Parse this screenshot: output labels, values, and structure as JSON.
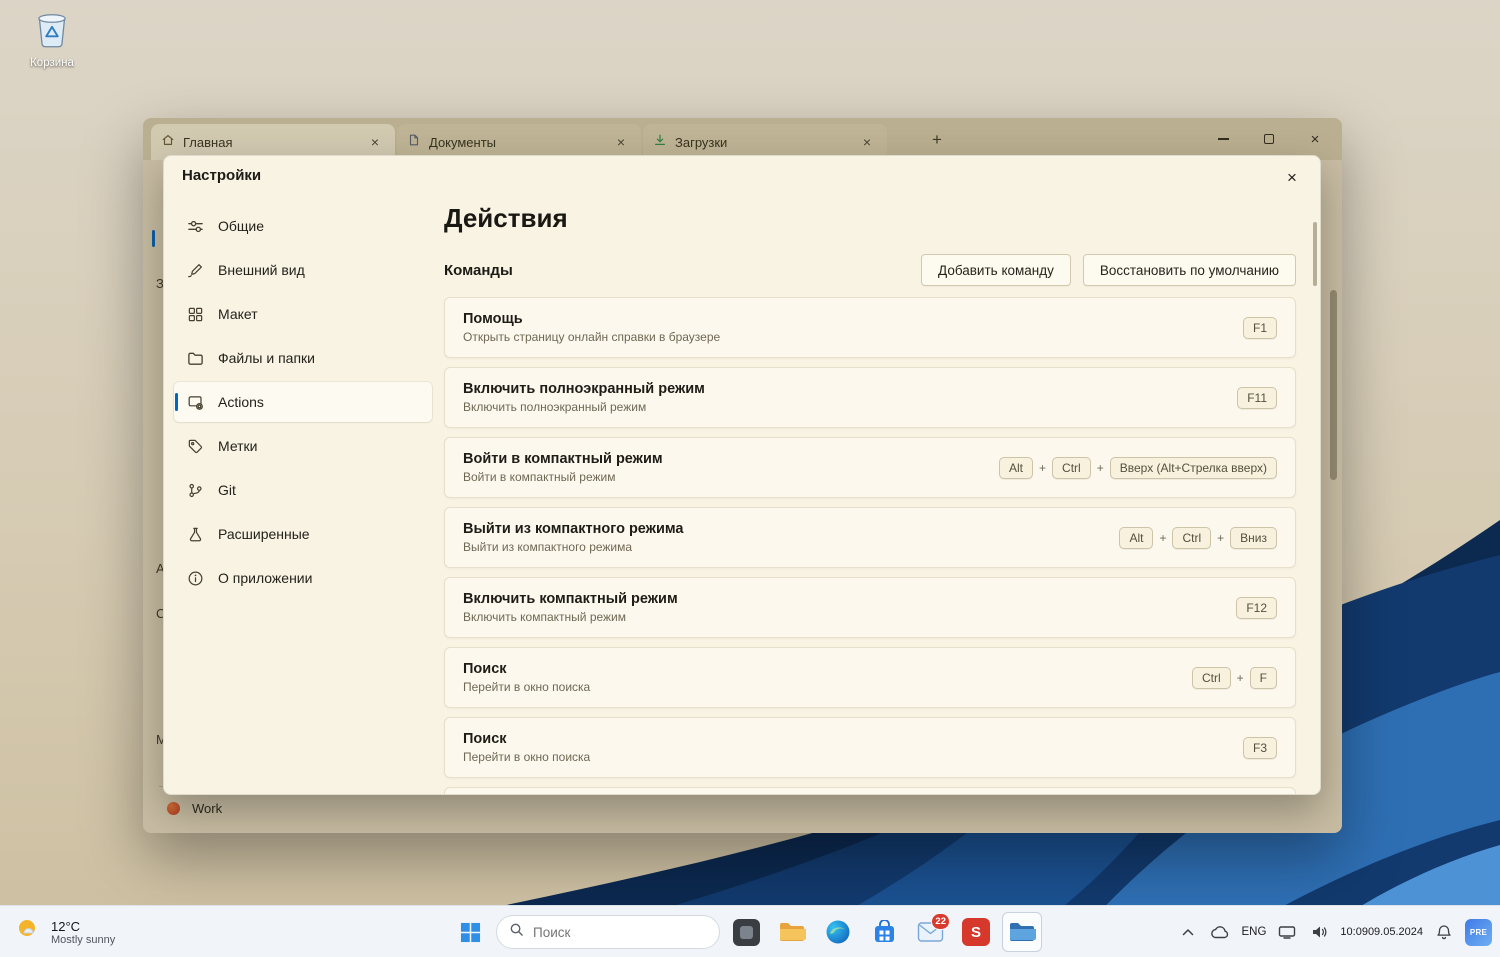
{
  "desktop": {
    "recycle_bin": {
      "label": "Корзина"
    }
  },
  "window": {
    "tabs": [
      {
        "label": "Главная",
        "icon": "home-icon",
        "active": true
      },
      {
        "label": "Документы",
        "icon": "document-icon",
        "active": false
      },
      {
        "label": "Загрузки",
        "icon": "download-icon",
        "active": false
      }
    ],
    "partial_sidebar": [
      "З",
      "А",
      "С",
      "М"
    ],
    "footer": {
      "work_label": "Work"
    }
  },
  "dialog": {
    "title": "Настройки",
    "page_title": "Действия",
    "section_title": "Команды",
    "add_command_label": "Добавить команду",
    "restore_defaults_label": "Восстановить по умолчанию",
    "accent_color": "#0067c0",
    "sidebar": [
      {
        "label": "Общие",
        "icon": "general-icon"
      },
      {
        "label": "Внешний вид",
        "icon": "appearance-icon"
      },
      {
        "label": "Макет",
        "icon": "layout-icon"
      },
      {
        "label": "Файлы и папки",
        "icon": "folders-icon"
      },
      {
        "label": "Actions",
        "icon": "actions-icon",
        "selected": true
      },
      {
        "label": "Метки",
        "icon": "tags-icon"
      },
      {
        "label": "Git",
        "icon": "git-icon"
      },
      {
        "label": "Расширенные",
        "icon": "advanced-icon"
      },
      {
        "label": "О приложении",
        "icon": "about-icon"
      }
    ],
    "commands": [
      {
        "title": "Помощь",
        "subtitle": "Открыть страницу онлайн справки в браузере",
        "keys": [
          "F1"
        ]
      },
      {
        "title": "Включить полноэкранный режим",
        "subtitle": "Включить полноэкранный режим",
        "keys": [
          "F11"
        ]
      },
      {
        "title": "Войти в компактный режим",
        "subtitle": "Войти в компактный режим",
        "keys": [
          "Alt",
          "Ctrl",
          "Вверх (Alt+Стрелка вверх)"
        ]
      },
      {
        "title": "Выйти из компактного режима",
        "subtitle": "Выйти из компактного режима",
        "keys": [
          "Alt",
          "Ctrl",
          "Вниз"
        ]
      },
      {
        "title": "Включить компактный режим",
        "subtitle": "Включить компактный режим",
        "keys": [
          "F12"
        ]
      },
      {
        "title": "Поиск",
        "subtitle": "Перейти в окно поиска",
        "keys": [
          "Ctrl",
          "F"
        ]
      },
      {
        "title": "Поиск",
        "subtitle": "Перейти в окно поиска",
        "keys": [
          "F3"
        ]
      }
    ]
  },
  "taskbar": {
    "weather": {
      "temp": "12°C",
      "condition": "Mostly sunny"
    },
    "search_placeholder": "Поиск",
    "mail_badge": "22",
    "s_app_label": "S",
    "tray": {
      "lang": "ENG",
      "time": "10:09",
      "date": "09.05.2024",
      "pre_label": "PRE"
    }
  }
}
